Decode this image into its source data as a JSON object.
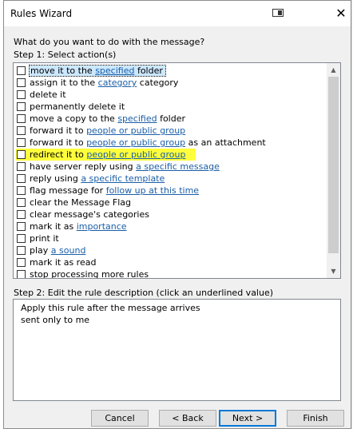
{
  "window": {
    "title": "Rules Wizard",
    "close_glyph": "✕",
    "restore_icon": "restore-icon"
  },
  "prompt": "What do you want to do with the message?",
  "step1_label": "Step 1: Select action(s)",
  "actions": [
    {
      "parts": [
        {
          "t": "move it to the "
        },
        {
          "t": "specified",
          "link": true
        },
        {
          "t": " folder"
        }
      ],
      "selected": true
    },
    {
      "parts": [
        {
          "t": "assign it to the "
        },
        {
          "t": "category",
          "link": true
        },
        {
          "t": " category"
        }
      ]
    },
    {
      "parts": [
        {
          "t": "delete it"
        }
      ]
    },
    {
      "parts": [
        {
          "t": "permanently delete it"
        }
      ]
    },
    {
      "parts": [
        {
          "t": "move a copy to the "
        },
        {
          "t": "specified",
          "link": true
        },
        {
          "t": " folder"
        }
      ]
    },
    {
      "parts": [
        {
          "t": "forward it to "
        },
        {
          "t": "people or public group",
          "link": true
        }
      ]
    },
    {
      "parts": [
        {
          "t": "forward it to "
        },
        {
          "t": "people or public group",
          "link": true
        },
        {
          "t": " as an attachment"
        }
      ]
    },
    {
      "parts": [
        {
          "t": "redirect it to "
        },
        {
          "t": "people or public group",
          "link": true
        }
      ],
      "highlighted": true
    },
    {
      "parts": [
        {
          "t": "have server reply using "
        },
        {
          "t": "a specific message",
          "link": true
        }
      ]
    },
    {
      "parts": [
        {
          "t": "reply using "
        },
        {
          "t": "a specific template",
          "link": true
        }
      ]
    },
    {
      "parts": [
        {
          "t": "flag message for "
        },
        {
          "t": "follow up at this time",
          "link": true
        }
      ]
    },
    {
      "parts": [
        {
          "t": "clear the Message Flag"
        }
      ]
    },
    {
      "parts": [
        {
          "t": "clear message's categories"
        }
      ]
    },
    {
      "parts": [
        {
          "t": "mark it as "
        },
        {
          "t": "importance",
          "link": true
        }
      ]
    },
    {
      "parts": [
        {
          "t": "print it"
        }
      ]
    },
    {
      "parts": [
        {
          "t": "play "
        },
        {
          "t": "a sound",
          "link": true
        }
      ]
    },
    {
      "parts": [
        {
          "t": "mark it as read"
        }
      ]
    },
    {
      "parts": [
        {
          "t": "stop processing more rules"
        }
      ]
    }
  ],
  "scrollbar": {
    "up": "▲",
    "down": "▼"
  },
  "step2_label": "Step 2: Edit the rule description (click an underlined value)",
  "description": [
    "Apply this rule after the message arrives",
    "sent only to me"
  ],
  "buttons": {
    "cancel": "Cancel",
    "back": "< Back",
    "next": "Next >",
    "finish": "Finish"
  },
  "colors": {
    "link": "#1a5ea7",
    "highlight": "#ffff3b",
    "accent": "#0078d7"
  }
}
